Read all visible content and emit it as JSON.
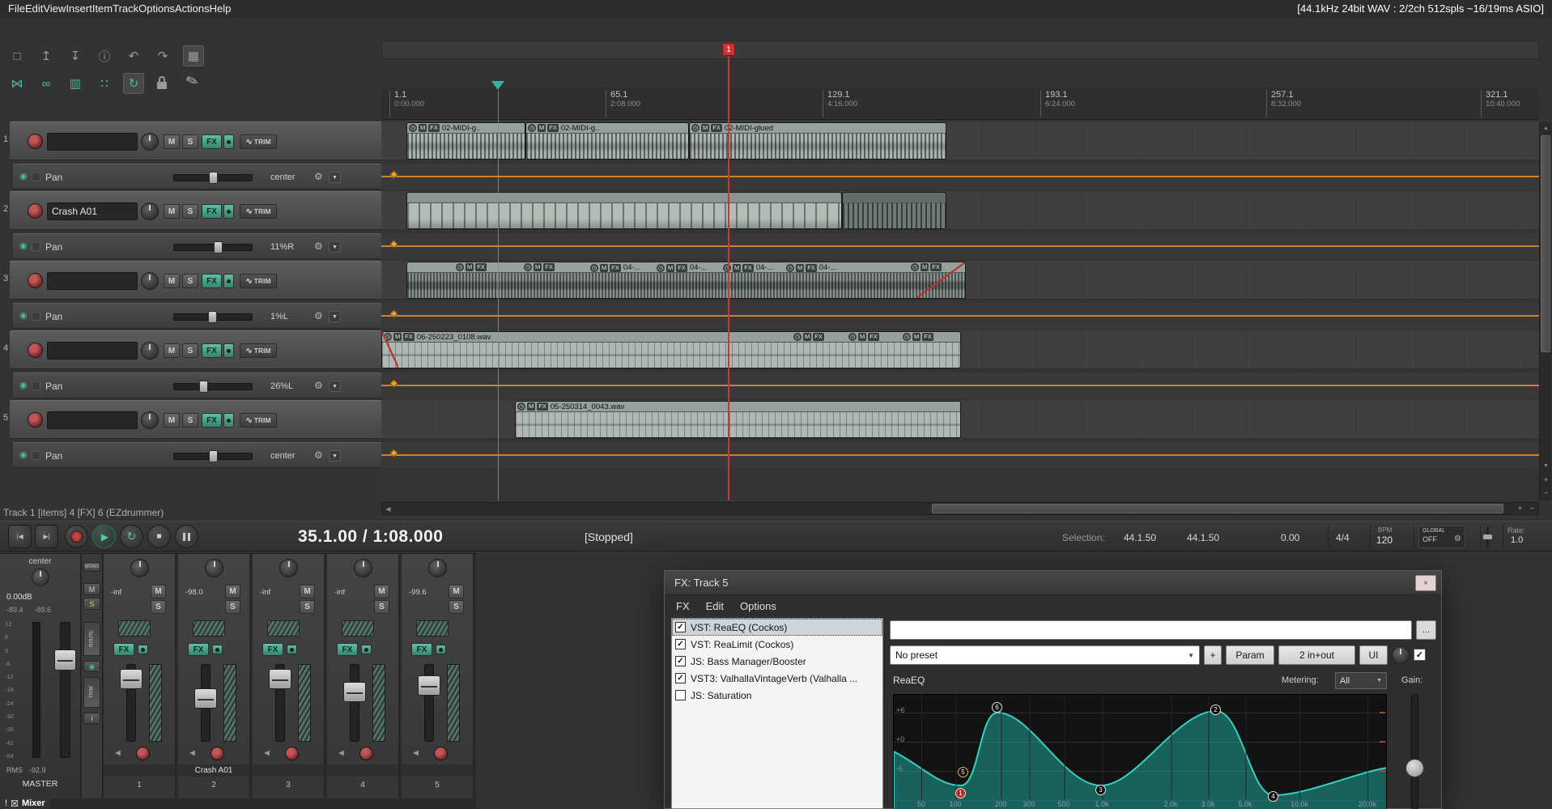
{
  "menubar": {
    "items": [
      "File",
      "Edit",
      "View",
      "Insert",
      "Item",
      "Track",
      "Options",
      "Actions",
      "Help"
    ],
    "audio_status": "[44.1kHz 24bit WAV : 2/2ch 512spls ~16/19ms ASIO]"
  },
  "icons": {
    "new_project": "□",
    "open_project": "↥",
    "save_project": "↧",
    "project_info": "ⓘ",
    "undo": "↶",
    "redo": "↷",
    "project_home": "⌂",
    "grid": "▦",
    "crossfade": "⋈",
    "item_group": "∞",
    "snap": "▥",
    "grid_dots": "∷",
    "ripple_edit": "↻",
    "pencil": "✎",
    "gear": "⚙",
    "dropdown_arrow": "▼",
    "power": "◉",
    "clock": "◷",
    "speaker": "◄",
    "wave": "∿",
    "prev": "|◀",
    "next": "▶|",
    "play": "▶",
    "stop": "■",
    "loop": "↻",
    "scroll_left": "◀",
    "scroll_up": "▲",
    "scroll_down": "▼",
    "plus": "+",
    "minus": "−",
    "close": "×",
    "boxed_check": "☒",
    "alert": "!"
  },
  "labels": {
    "mute": "M",
    "solo": "S",
    "fx": "FX",
    "trim": "TRIM"
  },
  "tracks": [
    {
      "number": "1",
      "name": "",
      "env_label": "Pan",
      "env_value": "center"
    },
    {
      "number": "2",
      "name": "Crash A01",
      "env_label": "Pan",
      "env_value": "11%R"
    },
    {
      "number": "3",
      "name": "",
      "env_label": "Pan",
      "env_value": "1%L"
    },
    {
      "number": "4",
      "name": "",
      "env_label": "Pan",
      "env_value": "26%L"
    },
    {
      "number": "5",
      "name": "",
      "env_label": "Pan",
      "env_value": "center"
    }
  ],
  "ruler": {
    "marks": [
      {
        "bar": "1.1",
        "time": "0:00.000"
      },
      {
        "bar": "65.1",
        "time": "2:08.000"
      },
      {
        "bar": "129.1",
        "time": "4:16.000"
      },
      {
        "bar": "193.1",
        "time": "6:24.000"
      },
      {
        "bar": "257.1",
        "time": "8:32.000"
      },
      {
        "bar": "321.1",
        "time": "10:40.000"
      }
    ],
    "marker_flag": "1"
  },
  "media_items": {
    "track1": [
      "02-MIDI-g..",
      "02-MIDI-g..",
      "02-MIDI-glued"
    ],
    "track3": "04-...",
    "track4": "06-250223_0108.wav",
    "track5": "05-250314_0043.wav"
  },
  "status_bar": {
    "text": "Track 1 [items] 4 [FX] 6 (EZdrummer)"
  },
  "transport": {
    "time_display": "35.1.00 / 1:08.000",
    "play_state": "[Stopped]",
    "selection_label": "Selection:",
    "selection_start": "44.1.50",
    "selection_end": "44.1.50",
    "selection_length": "0.00",
    "time_signature": "4/4",
    "bpm_label": "BPM",
    "bpm_value": "120",
    "global_label": "GLOBAL",
    "global_value": "OFF",
    "rate_label": "Rate:",
    "rate_value": "1.0"
  },
  "mixer": {
    "master": {
      "pan": "center",
      "volume": "0.00dB",
      "peak_left": "-89.4",
      "peak_right": "-89.6",
      "scale": [
        "12",
        "6",
        "0",
        "-6",
        "-12",
        "-18",
        "-24",
        "-30",
        "-36",
        "-42",
        "-54"
      ],
      "rms_label": "RMS",
      "rms_value": "-92.9",
      "label": "MASTER"
    },
    "controls": {
      "mono": "MONO",
      "mute": "M",
      "solo": "S",
      "route": "ROUTE",
      "trim": "TRIM",
      "info": "i"
    },
    "channels": [
      {
        "number": "1",
        "value": "-inf",
        "name": ""
      },
      {
        "number": "2",
        "value": "-98.0",
        "name": "Crash A01"
      },
      {
        "number": "3",
        "value": "-inf",
        "name": ""
      },
      {
        "number": "4",
        "value": "-inf",
        "name": ""
      },
      {
        "number": "5",
        "value": "-99.6",
        "name": ""
      }
    ],
    "tab_alert": "!",
    "tab_label": "Mixer"
  },
  "fx_window": {
    "title": "FX: Track 5",
    "menu_items": [
      "FX",
      "Edit",
      "Options"
    ],
    "plugins": [
      {
        "name": "VST: ReaEQ (Cockos)",
        "enabled": true,
        "selected": true
      },
      {
        "name": "VST: ReaLimit (Cockos)",
        "enabled": true,
        "selected": false
      },
      {
        "name": "JS: Bass Manager/Booster",
        "enabled": true,
        "selected": false
      },
      {
        "name": "VST3: ValhallaVintageVerb (Valhalla ...",
        "enabled": true,
        "selected": false
      },
      {
        "name": "JS: Saturation",
        "enabled": false,
        "selected": false
      }
    ],
    "preset_value": "No preset",
    "more_button": "...",
    "add_button": "+",
    "param_button": "Param",
    "io_button": "2 in+out",
    "ui_button": "UI",
    "plugin_title": "ReaEQ",
    "metering_label": "Metering:",
    "metering_value": "All",
    "gain_label": "Gain:",
    "eq_graph": {
      "db_labels": [
        "+6",
        "+0",
        "-6"
      ],
      "freq_labels": [
        "50",
        "100",
        "200",
        "300",
        "500",
        "1.0k",
        "2.0k",
        "3.0k",
        "5.0k",
        "10.0k",
        "20.0k"
      ],
      "bands": [
        "1",
        "2",
        "3",
        "4",
        "5",
        "6"
      ]
    }
  }
}
